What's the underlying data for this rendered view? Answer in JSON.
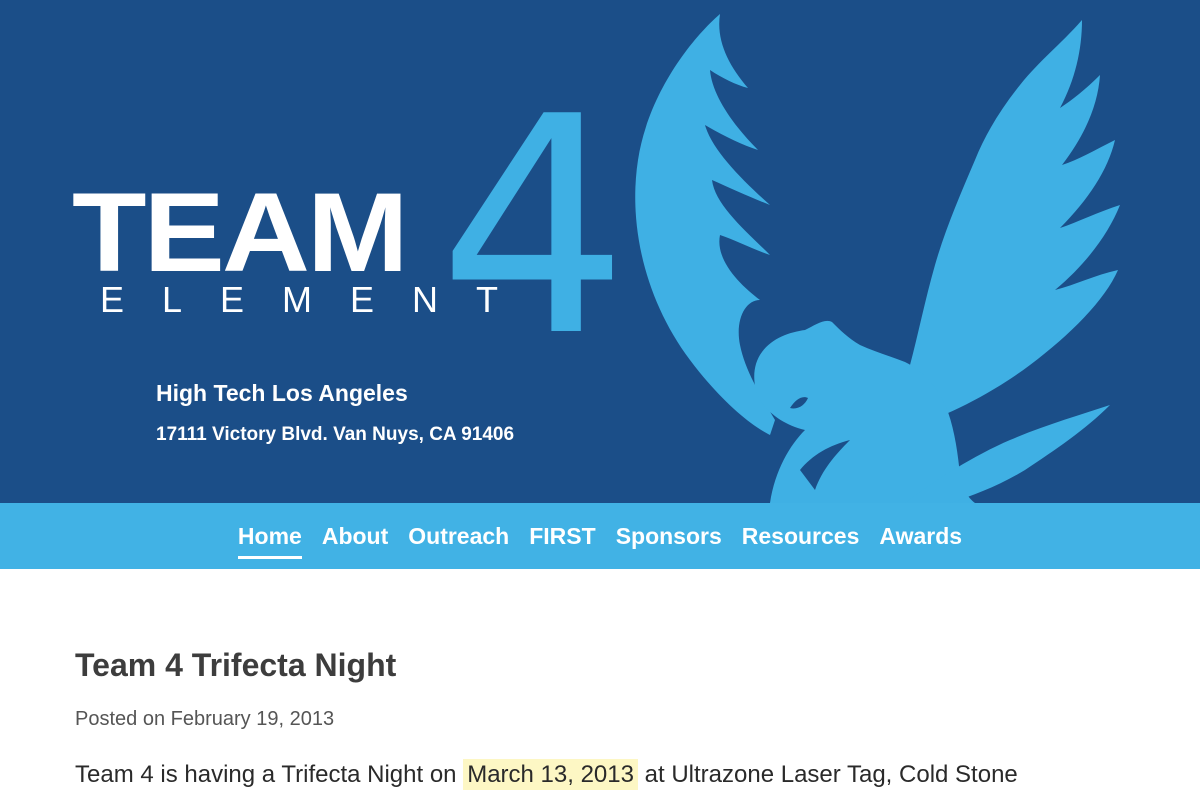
{
  "header": {
    "logo": {
      "team_text": "TEAM",
      "number_text": "4",
      "element_text": "ELEMENT"
    },
    "school_name": "High Tech Los Angeles",
    "address": "17111 Victory Blvd. Van Nuys, CA 91406",
    "colors": {
      "background": "#1b4e88",
      "accent": "#3fb0e4"
    },
    "mascot_icon": "phoenix-icon"
  },
  "nav": {
    "items": [
      {
        "label": "Home",
        "active": true
      },
      {
        "label": "About",
        "active": false
      },
      {
        "label": "Outreach",
        "active": false
      },
      {
        "label": "FIRST",
        "active": false
      },
      {
        "label": "Sponsors",
        "active": false
      },
      {
        "label": "Resources",
        "active": false
      },
      {
        "label": "Awards",
        "active": false
      }
    ],
    "background": "#41b2e5"
  },
  "post": {
    "title": "Team 4 Trifecta Night",
    "meta": "Posted on February 19, 2013",
    "body_before": "Team 4 is having a Trifecta Night on ",
    "body_highlight": "March 13, 2013",
    "body_after": " at Ultrazone Laser Tag, Cold Stone"
  }
}
